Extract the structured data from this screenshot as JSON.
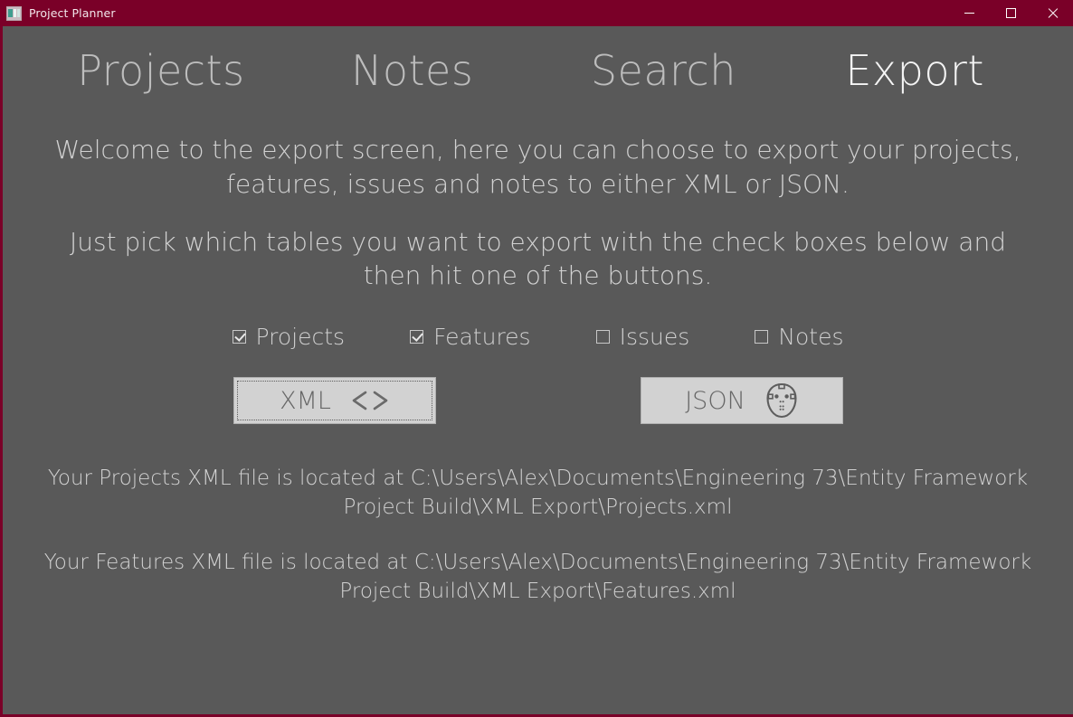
{
  "window": {
    "title": "Project Planner",
    "icon": "app-window-icon",
    "titlebar_color": "#7a0028",
    "client_color": "#595959",
    "controls": {
      "minimize": "minimize-icon",
      "maximize": "maximize-icon",
      "close": "close-icon"
    }
  },
  "nav": {
    "items": [
      {
        "label": "Projects",
        "active": false
      },
      {
        "label": "Notes",
        "active": false
      },
      {
        "label": "Search",
        "active": false
      },
      {
        "label": "Export",
        "active": true
      }
    ]
  },
  "main": {
    "intro_paragraph": "Welcome to the export screen, here you can choose to export your projects, features, issues and notes to either XML or JSON.",
    "instruction_paragraph": "Just pick which tables you want to export with the check boxes below and then hit one of the buttons.",
    "checkboxes": [
      {
        "label": "Projects",
        "checked": true
      },
      {
        "label": "Features",
        "checked": true
      },
      {
        "label": "Issues",
        "checked": false
      },
      {
        "label": "Notes",
        "checked": false
      }
    ],
    "buttons": [
      {
        "label": "XML",
        "icon": "code-brackets-icon",
        "focused": true
      },
      {
        "label": "JSON",
        "icon": "hockey-mask-icon",
        "focused": false
      }
    ],
    "status_messages": [
      "Your Projects XML file is located at C:\\Users\\Alex\\Documents\\Engineering 73\\Entity Framework Project Build\\XML Export\\Projects.xml",
      "Your Features XML file is located at C:\\Users\\Alex\\Documents\\Engineering 73\\Entity Framework Project Build\\XML Export\\Features.xml"
    ]
  }
}
